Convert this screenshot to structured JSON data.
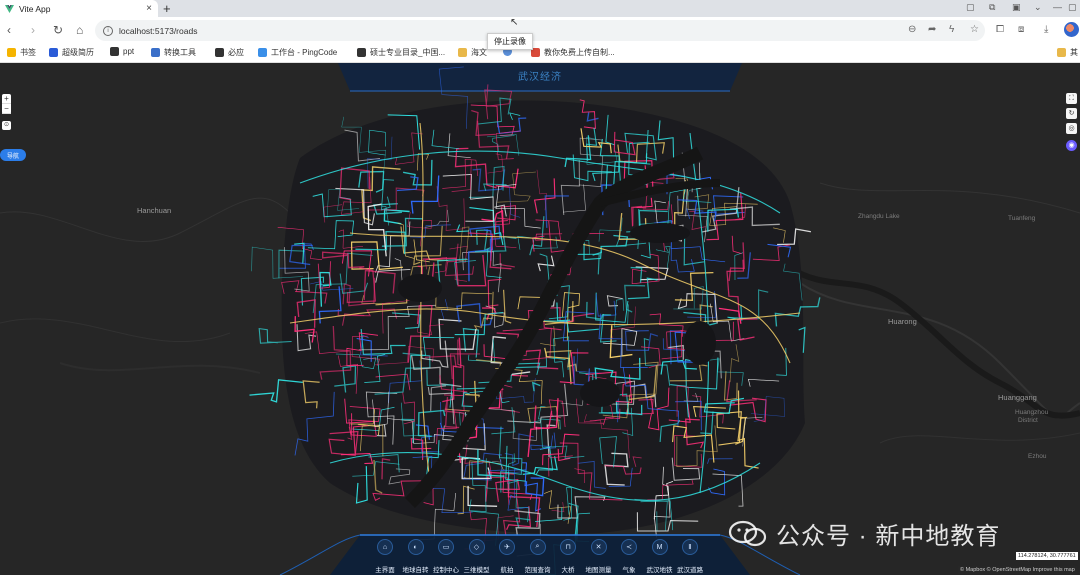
{
  "browser": {
    "tab_title": "Vite App",
    "tab_close": "×",
    "new_tab": "+",
    "url": "localhost:5173/roads",
    "tooltip": "停止录像",
    "bookmarks": [
      {
        "label": "书签",
        "icon": "star-icon",
        "color": "#f5b400"
      },
      {
        "label": "超级简历",
        "icon": "ai-icon",
        "color": "#2a5bd7"
      },
      {
        "label": "ppt",
        "icon": "face-icon",
        "color": "#333333"
      },
      {
        "label": "转换工具",
        "icon": "tool-icon",
        "color": "#3a6fc9"
      },
      {
        "label": "必应",
        "icon": "search-icon",
        "color": "#333333"
      },
      {
        "label": "工作台 - PingCode",
        "icon": "pingcode-icon",
        "color": "#3a8fe8"
      },
      {
        "label": "硕士专业目录_中国...",
        "icon": "cap-icon",
        "color": "#333333"
      },
      {
        "label": "海文",
        "icon": "folder-icon",
        "color": "#e8b84a"
      },
      {
        "label": "",
        "icon": "globe-icon",
        "color": "#5a8fd8"
      },
      {
        "label": "教你免费上传自制...",
        "icon": "c-icon",
        "color": "#d94a3a"
      }
    ],
    "bookmarks_right": "其"
  },
  "map": {
    "header_title": "武汉经济",
    "nav_pill": "导航",
    "zoom_in": "+",
    "zoom_out": "−",
    "places": [
      {
        "name": "Hanchuan",
        "big": true
      },
      {
        "name": "Huarong",
        "big": true
      },
      {
        "name": "Huanggang",
        "big": true
      },
      {
        "name": "Huangzhou",
        "big": false
      },
      {
        "name": "District",
        "big": false
      },
      {
        "name": "Ezhou",
        "big": false
      },
      {
        "name": "Tuanfeng",
        "big": false
      },
      {
        "name": "Zhangdu Lake",
        "big": false
      }
    ],
    "dock": [
      {
        "label": "主界面",
        "icon": "home-icon",
        "glyph": "⌂"
      },
      {
        "label": "地球自转",
        "icon": "globe-icon",
        "glyph": "◐"
      },
      {
        "label": "控制中心",
        "icon": "monitor-icon",
        "glyph": "▭"
      },
      {
        "label": "三维模型",
        "icon": "cube-icon",
        "glyph": "◇"
      },
      {
        "label": "航拍",
        "icon": "drone-icon",
        "glyph": "✈"
      },
      {
        "label": "范围查询",
        "icon": "query-icon",
        "glyph": "⌕"
      },
      {
        "label": "大桥",
        "icon": "bridge-icon",
        "glyph": "⊓"
      },
      {
        "label": "地图测量",
        "icon": "measure-icon",
        "glyph": "✕"
      },
      {
        "label": "气象",
        "icon": "weather-icon",
        "glyph": "≺"
      },
      {
        "label": "武汉地铁",
        "icon": "metro-icon",
        "glyph": "M"
      },
      {
        "label": "武汉道路",
        "icon": "road-icon",
        "glyph": "Ⅱ"
      }
    ],
    "attribution": "© Mapbox © OpenStreetMap  Improve this map",
    "coords": "114.278124, 30.777761"
  },
  "watermark": "公众号 · 新中地教育",
  "colors": {
    "road_pink": "#ff2f7a",
    "road_cyan": "#30e0e0",
    "road_yellow": "#f5d06a",
    "road_blue": "#2f6cff",
    "road_white": "#f0f0f0",
    "river": "#151515"
  }
}
